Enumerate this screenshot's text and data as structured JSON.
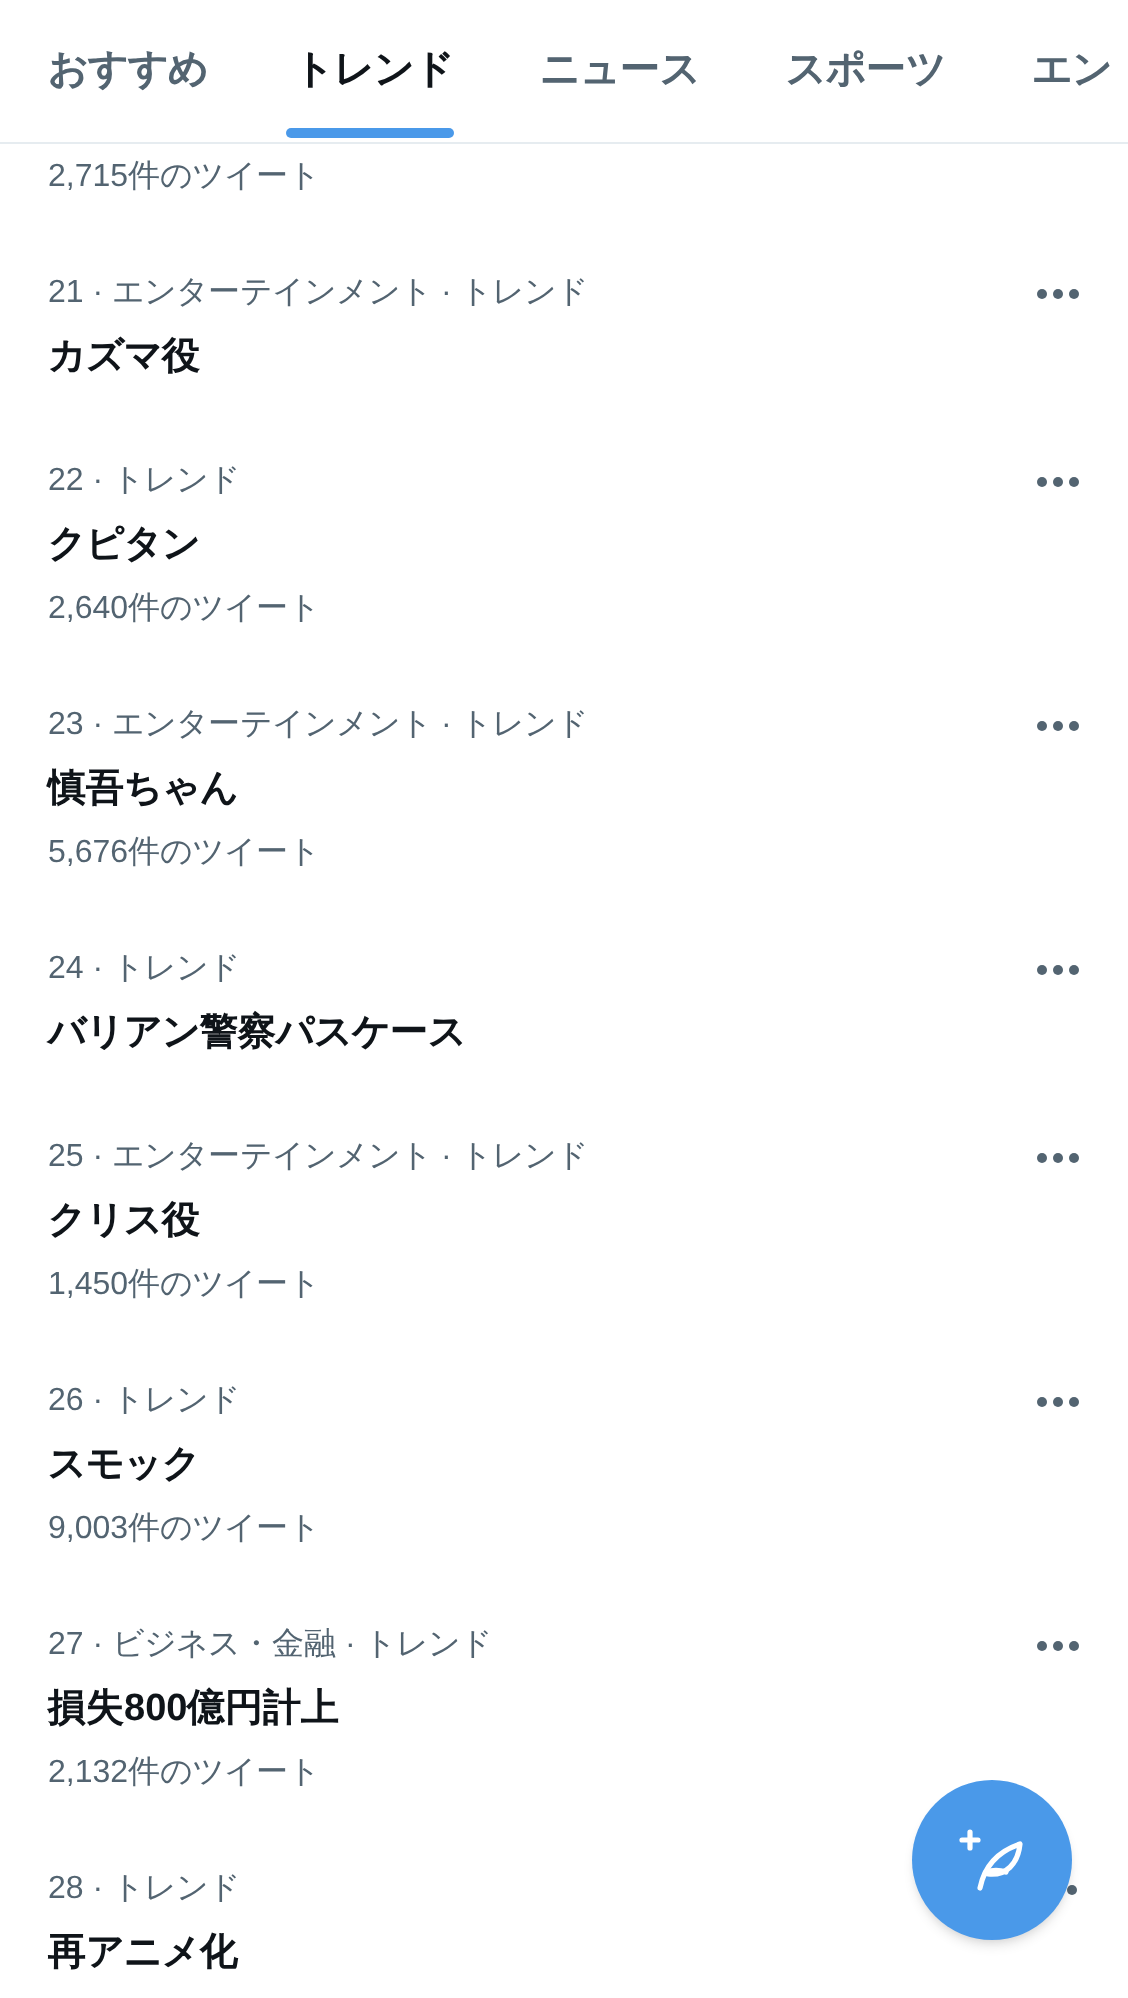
{
  "tabs": [
    {
      "label": "おすすめ",
      "selected": false
    },
    {
      "label": "トレンド",
      "selected": true
    },
    {
      "label": "ニュース",
      "selected": false
    },
    {
      "label": "スポーツ",
      "selected": false
    },
    {
      "label": "エン",
      "selected": false
    }
  ],
  "trends": [
    {
      "count": "2,715件のツイート"
    },
    {
      "meta": "21 · エンターテインメント · トレンド",
      "title": "カズマ役"
    },
    {
      "meta": "22 · トレンド",
      "title": "クピタン",
      "count": "2,640件のツイート"
    },
    {
      "meta": "23 · エンターテインメント · トレンド",
      "title": "慎吾ちゃん",
      "count": "5,676件のツイート"
    },
    {
      "meta": "24 · トレンド",
      "title": "バリアン警察パスケース"
    },
    {
      "meta": "25 · エンターテインメント · トレンド",
      "title": "クリス役",
      "count": "1,450件のツイート"
    },
    {
      "meta": "26 · トレンド",
      "title": "スモック",
      "count": "9,003件のツイート"
    },
    {
      "meta": "27 · ビジネス・金融 · トレンド",
      "title": "損失800億円計上",
      "count": "2,132件のツイート"
    },
    {
      "meta": "28 · トレンド",
      "title": "再アニメ化"
    }
  ]
}
